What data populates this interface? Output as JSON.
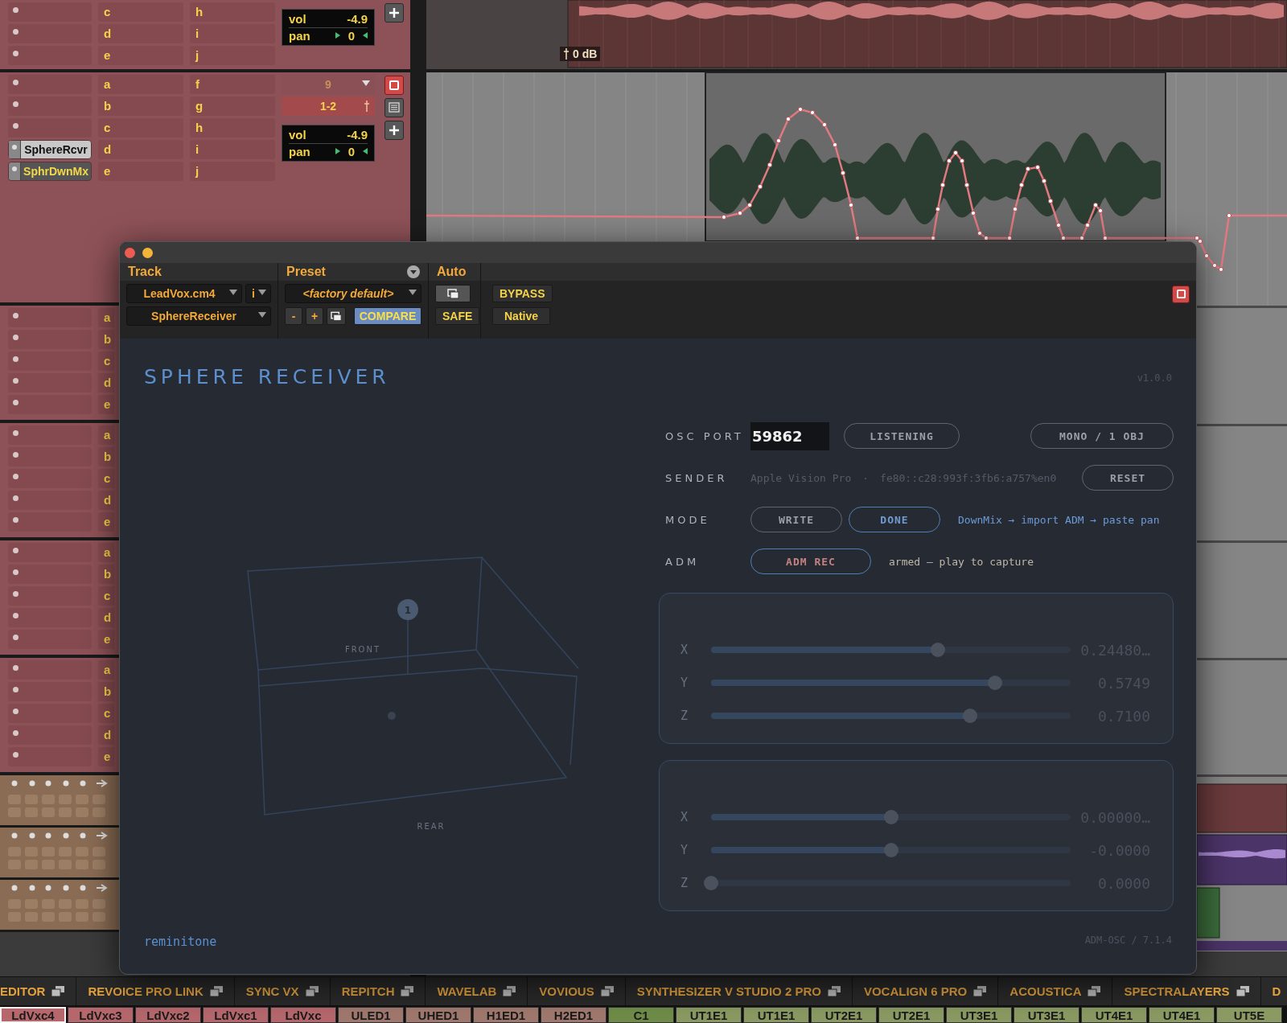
{
  "mixer": {
    "groups": [
      {
        "inserts": [
          {
            "kind": "empty"
          },
          {
            "kind": "empty"
          },
          {
            "kind": "empty"
          }
        ],
        "column_2": [
          "c",
          "d",
          "e"
        ],
        "column_3": [
          "h",
          "i",
          "j"
        ],
        "meter": {
          "vol_label": "vol",
          "vol": "-4.9",
          "pan_label": "pan",
          "pan": "0"
        },
        "buttons": [
          {
            "kind": "add"
          }
        ]
      },
      {
        "inserts": [
          {
            "kind": "empty"
          },
          {
            "kind": "empty"
          },
          {
            "kind": "empty"
          },
          {
            "kind": "plugin",
            "name": "SphereRcvr",
            "selected": true
          },
          {
            "kind": "plugin",
            "name": "SphrDwnMx",
            "selected": false
          }
        ],
        "column_2": [
          "a",
          "b",
          "c",
          "d",
          "e"
        ],
        "column_3": [
          "f",
          "g",
          "h",
          "i",
          "j"
        ],
        "input": "9",
        "output": "1-2",
        "meter": {
          "vol_label": "vol",
          "vol": "-4.9",
          "pan_label": "pan",
          "pan": "0"
        },
        "buttons": [
          {
            "kind": "record"
          },
          {
            "kind": "comment"
          },
          {
            "kind": "add"
          }
        ]
      },
      {
        "inserts": [
          {
            "kind": "empty"
          },
          {
            "kind": "empty"
          },
          {
            "kind": "empty"
          },
          {
            "kind": "empty"
          },
          {
            "kind": "empty"
          }
        ],
        "column_2": [
          "a",
          "b",
          "c",
          "d",
          "e"
        ]
      },
      {
        "inserts": [
          {
            "kind": "empty"
          },
          {
            "kind": "empty"
          },
          {
            "kind": "empty"
          },
          {
            "kind": "empty"
          },
          {
            "kind": "empty"
          }
        ],
        "column_2": [
          "a",
          "b",
          "c",
          "d",
          "e"
        ]
      },
      {
        "inserts": [
          {
            "kind": "empty"
          },
          {
            "kind": "empty"
          },
          {
            "kind": "empty"
          },
          {
            "kind": "empty"
          },
          {
            "kind": "empty"
          }
        ],
        "column_2": [
          "a",
          "b",
          "c",
          "d",
          "e"
        ]
      },
      {
        "inserts": [
          {
            "kind": "empty"
          },
          {
            "kind": "empty"
          },
          {
            "kind": "empty"
          },
          {
            "kind": "empty"
          },
          {
            "kind": "empty"
          }
        ],
        "column_2": [
          "a",
          "b",
          "c",
          "d",
          "e"
        ]
      }
    ]
  },
  "timeline": {
    "clip_gain": "0 dB"
  },
  "plugin": {
    "header": {
      "track_label": "Track",
      "preset_label": "Preset",
      "auto_label": "Auto",
      "track_name": "LeadVox.cm4",
      "insert_letter": "i",
      "plugin_name": "SphereReceiver",
      "preset": "<factory default>",
      "preset_minus": "-",
      "preset_plus": "+",
      "compare": "COMPARE",
      "safe": "SAFE",
      "bypass": "BYPASS",
      "native": "Native"
    },
    "title": "SPHERE RECEIVER",
    "version": "v1.0.0",
    "scene": {
      "object_label": "1",
      "front_label": "FRONT",
      "rear_label": "REAR"
    },
    "osc_port": {
      "label": "OSC PORT",
      "value": "59862",
      "status": "LISTENING",
      "format": "MONO / 1 OBJ"
    },
    "sender": {
      "label": "SENDER",
      "device": "Apple Vision Pro",
      "separator": "·",
      "address": "fe80::c28:993f:3fb6:a757%en0",
      "reset": "RESET"
    },
    "mode": {
      "label": "MODE",
      "options": [
        {
          "label": "WRITE",
          "selected": false
        },
        {
          "label": "DONE",
          "selected": true
        }
      ],
      "hint": "DownMix → import ADM → paste pan"
    },
    "adm": {
      "label": "ADM",
      "button": "ADM REC",
      "armed": true,
      "status": "armed — play to capture"
    },
    "panels": [
      {
        "sliders": [
          {
            "axis": "X",
            "level": 0.63,
            "reading": "0.24480…"
          },
          {
            "axis": "Y",
            "level": 0.79,
            "reading": "0.5749"
          },
          {
            "axis": "Z",
            "level": 0.72,
            "reading": "0.7100"
          }
        ]
      },
      {
        "sliders": [
          {
            "axis": "X",
            "level": 0.5,
            "reading": "0.00000…"
          },
          {
            "axis": "Y",
            "level": 0.5,
            "reading": "-0.0000"
          },
          {
            "axis": "Z",
            "level": 0,
            "reading": "0.0000"
          }
        ]
      }
    ],
    "brand": "reminitone",
    "footer": "ADM-OSC / 7.1.4"
  },
  "window_tabs": [
    "EDITOR",
    "REVOICE PRO LINK",
    "SYNC VX",
    "REPITCH",
    "WAVELAB",
    "VOVIOUS",
    "SYNTHESIZER V STUDIO 2 PRO",
    "VOCALIGN 6 PRO",
    "ACOUSTICA",
    "SPECTRALAYERS",
    "D"
  ],
  "clip_names": [
    {
      "name": "LdVxc4",
      "selected": true,
      "color": "#b5676c"
    },
    {
      "name": "LdVxc3",
      "selected": false,
      "color": "#b5676c"
    },
    {
      "name": "LdVxc2",
      "selected": false,
      "color": "#b5676c"
    },
    {
      "name": "LdVxc1",
      "selected": false,
      "color": "#b5676c"
    },
    {
      "name": "LdVxc",
      "selected": false,
      "color": "#b5676c"
    },
    {
      "name": "ULED1",
      "selected": false,
      "color": "#a0786e"
    },
    {
      "name": "UHED1",
      "selected": false,
      "color": "#a0786e"
    },
    {
      "name": "H1ED1",
      "selected": false,
      "color": "#a0786e"
    },
    {
      "name": "H2ED1",
      "selected": false,
      "color": "#a0786e"
    },
    {
      "name": "C1",
      "selected": false,
      "color": "#6f8c48"
    },
    {
      "name": "UT1E1",
      "selected": false,
      "color": "#8a9a62"
    },
    {
      "name": "UT1E1",
      "selected": false,
      "color": "#8a9a62"
    },
    {
      "name": "UT2E1",
      "selected": false,
      "color": "#8a9a62"
    },
    {
      "name": "UT2E1",
      "selected": false,
      "color": "#8a9a62"
    },
    {
      "name": "UT3E1",
      "selected": false,
      "color": "#8a9a62"
    },
    {
      "name": "UT3E1",
      "selected": false,
      "color": "#8a9a62"
    },
    {
      "name": "UT4E1",
      "selected": false,
      "color": "#8a9a62"
    },
    {
      "name": "UT4E1",
      "selected": false,
      "color": "#8a9a62"
    },
    {
      "name": "UT5E",
      "selected": false,
      "color": "#8a9a62"
    }
  ]
}
